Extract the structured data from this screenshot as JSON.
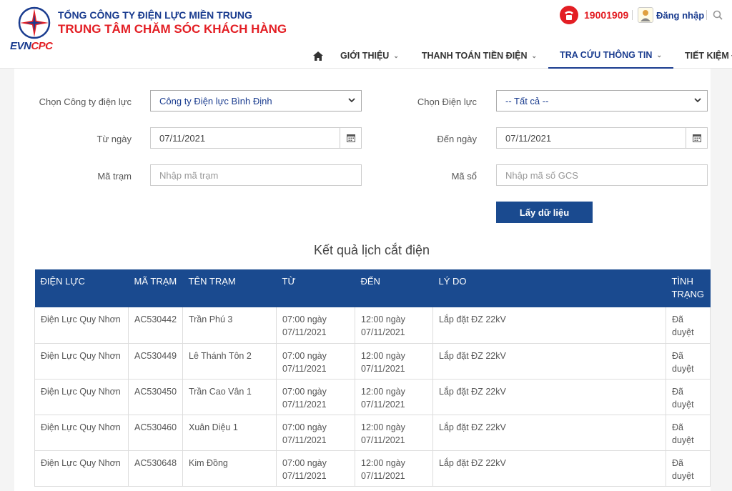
{
  "header": {
    "org_line1": "TỔNG CÔNG TY ĐIỆN LỰC MIỀN TRUNG",
    "org_line2": "TRUNG TÂM CHĂM SÓC KHÁCH HÀNG",
    "logo_evn": "EVN",
    "logo_cpc": "CPC",
    "hotline": "19001909",
    "login": "Đăng nhập"
  },
  "nav": {
    "items": [
      {
        "label": "GIỚI THIỆU"
      },
      {
        "label": "THANH TOÁN TIỀN ĐIỆN"
      },
      {
        "label": "TRA CỨU THÔNG TIN"
      },
      {
        "label": "TIẾT KIỆM ĐIỆN"
      }
    ]
  },
  "form": {
    "company_label": "Chọn Công ty điện lực",
    "company_value": "Công ty Điện lực Bình Định",
    "unit_label": "Chọn Điện lực",
    "unit_value": "-- Tất cả --",
    "from_label": "Từ ngày",
    "from_value": "07/11/2021",
    "to_label": "Đến ngày",
    "to_value": "07/11/2021",
    "station_label": "Mã trạm",
    "station_placeholder": "Nhập mã trạm",
    "gcs_label": "Mã sổ",
    "gcs_placeholder": "Nhập mã số GCS",
    "submit": "Lấy dữ liệu"
  },
  "result_title": "Kết quả lịch cắt điện",
  "table": {
    "headers": [
      "ĐIỆN LỰC",
      "MÃ TRẠM",
      "TÊN TRẠM",
      "TỪ",
      "ĐẾN",
      "LÝ DO",
      "TÌNH TRẠNG"
    ],
    "rows": [
      [
        "Điện Lực Quy Nhơn",
        "AC530442",
        "Trần Phú 3",
        "07:00 ngày 07/11/2021",
        "12:00 ngày 07/11/2021",
        "Lắp đặt ĐZ 22kV",
        "Đã duyệt"
      ],
      [
        "Điện Lực Quy Nhơn",
        "AC530449",
        "Lê Thánh Tôn 2",
        "07:00 ngày 07/11/2021",
        "12:00 ngày 07/11/2021",
        "Lắp đặt ĐZ 22kV",
        "Đã duyệt"
      ],
      [
        "Điện Lực Quy Nhơn",
        "AC530450",
        "Trần Cao Vân 1",
        "07:00 ngày 07/11/2021",
        "12:00 ngày 07/11/2021",
        "Lắp đặt ĐZ 22kV",
        "Đã duyệt"
      ],
      [
        "Điện Lực Quy Nhơn",
        "AC530460",
        "Xuân Diệu 1",
        "07:00 ngày 07/11/2021",
        "12:00 ngày 07/11/2021",
        "Lắp đặt ĐZ 22kV",
        "Đã duyệt"
      ],
      [
        "Điện Lực Quy Nhơn",
        "AC530648",
        "Kim Đồng",
        "07:00 ngày 07/11/2021",
        "12:00 ngày 07/11/2021",
        "Lắp đặt ĐZ 22kV",
        "Đã duyệt"
      ]
    ]
  },
  "colors": {
    "brand_blue": "#1a4a8f",
    "brand_red": "#e31e24"
  }
}
